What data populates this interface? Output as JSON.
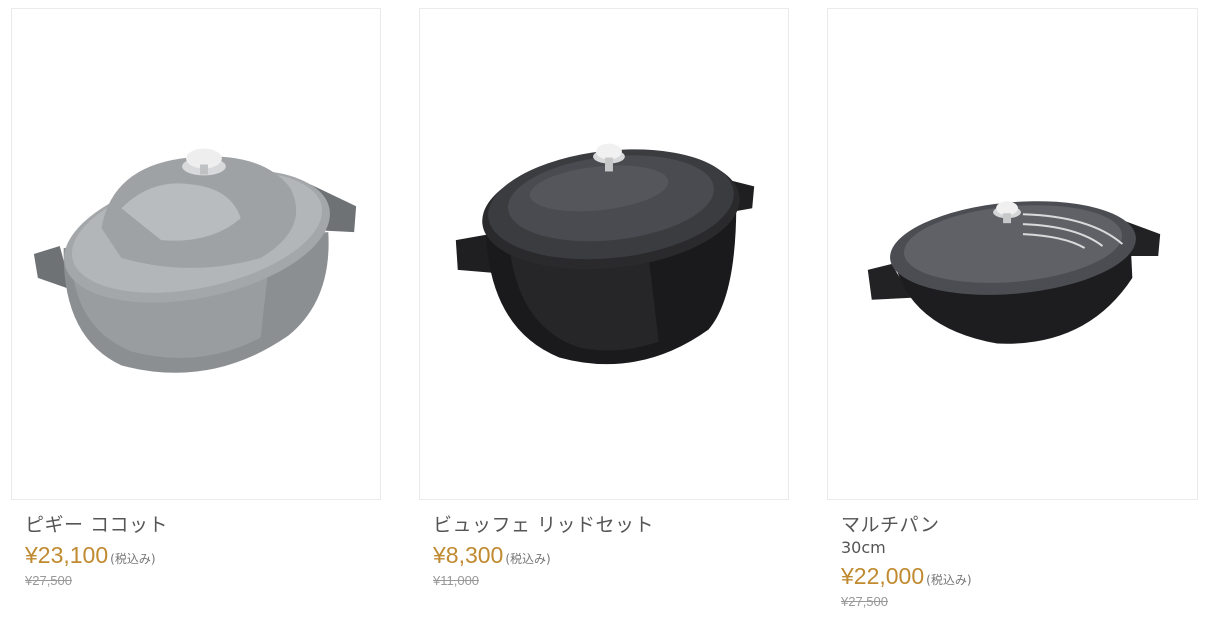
{
  "products": [
    {
      "name": "ピギー ココット",
      "variant": "",
      "price": "¥23,100",
      "tax_label": "(税込み)",
      "original_price": "¥27,500",
      "image": "grey-oval-cocotte-pig-lid"
    },
    {
      "name": "ビュッフェ リッドセット",
      "variant": "",
      "price": "¥8,300",
      "tax_label": "(税込み)",
      "original_price": "¥11,000",
      "image": "black-round-pot-glass-lid"
    },
    {
      "name": "マルチパン",
      "variant": "30cm",
      "price": "¥22,000",
      "tax_label": "(税込み)",
      "original_price": "¥27,500",
      "image": "black-wok-glass-lid"
    }
  ],
  "colors": {
    "price": "#c08a30",
    "text": "#555555",
    "border": "#ebebeb"
  }
}
